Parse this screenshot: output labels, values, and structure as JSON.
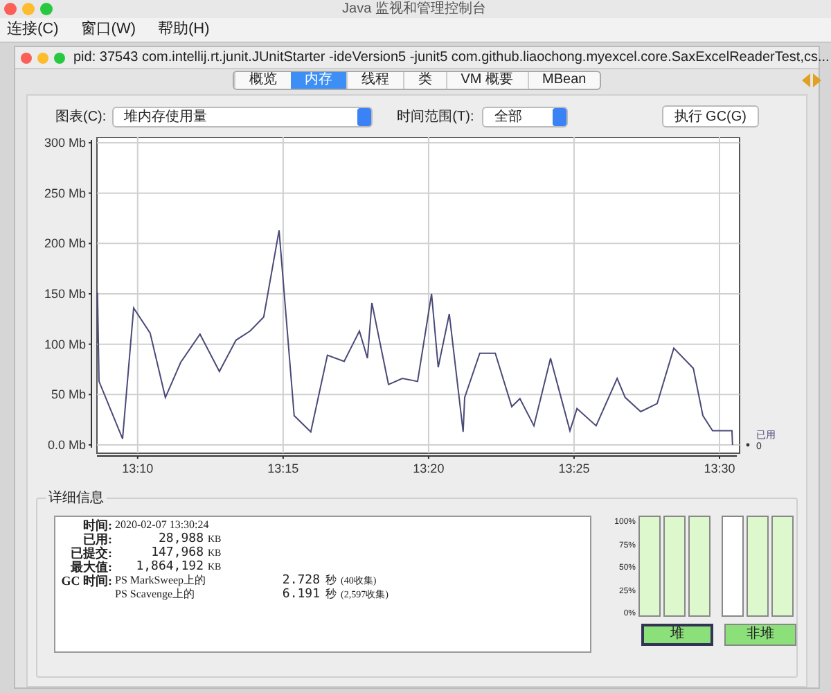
{
  "window": {
    "title": "Java 监视和管理控制台"
  },
  "menu": [
    "连接(C)",
    "窗口(W)",
    "帮助(H)"
  ],
  "inner_window": {
    "title": "pid: 37543 com.intellij.rt.junit.JUnitStarter -ideVersion5 -junit5 com.github.liaochong.myexcel.core.SaxExcelReaderTest,cs..."
  },
  "tabs": [
    {
      "label": "概览",
      "selected": false
    },
    {
      "label": "内存",
      "selected": true
    },
    {
      "label": "线程",
      "selected": false
    },
    {
      "label": "类",
      "selected": false
    },
    {
      "label": "VM 概要",
      "selected": false
    },
    {
      "label": "MBean",
      "selected": false
    }
  ],
  "chart_select": {
    "label": "图表(C):",
    "value": "堆内存使用量"
  },
  "range_select": {
    "label": "时间范围(T):",
    "value": "全部"
  },
  "gc_button": "执行 GC(G)",
  "memory_chart": {
    "chart_data": {
      "type": "line",
      "grid": true,
      "xlim": [
        788.6,
        810.5
      ],
      "ylim": [
        0,
        300
      ],
      "yticks": [
        {
          "value": 0,
          "label": "0.0 Mb"
        },
        {
          "value": 50,
          "label": "50 Mb"
        },
        {
          "value": 100,
          "label": "100 Mb"
        },
        {
          "value": 150,
          "label": "150 Mb"
        },
        {
          "value": 200,
          "label": "200 Mb"
        },
        {
          "value": 250,
          "label": "250 Mb"
        },
        {
          "value": 300,
          "label": "300 Mb"
        }
      ],
      "xticks": [
        {
          "value": 790,
          "label": "13:10"
        },
        {
          "value": 795,
          "label": "13:15"
        },
        {
          "value": 800,
          "label": "13:20"
        },
        {
          "value": 805,
          "label": "13:25"
        },
        {
          "value": 810,
          "label": "13:30"
        }
      ],
      "x": [
        788.62,
        788.67,
        789.48,
        789.86,
        790.43,
        790.95,
        791.48,
        792.14,
        792.81,
        793.38,
        793.86,
        794.33,
        794.86,
        795.38,
        795.95,
        796.52,
        797.1,
        797.62,
        797.9,
        798.05,
        798.62,
        799.1,
        799.62,
        800.1,
        800.33,
        800.71,
        801.19,
        801.24,
        801.76,
        802.29,
        802.86,
        803.14,
        803.62,
        804.19,
        804.86,
        805.1,
        805.76,
        806.48,
        806.76,
        807.29,
        807.86,
        808.43,
        809.1,
        809.43,
        809.76,
        810.43,
        810.45
      ],
      "series": [
        {
          "name": "已用",
          "color": "#4a4a78",
          "values": [
            151,
            63,
            6,
            136,
            111,
            47,
            82,
            110,
            73,
            104,
            113,
            127,
            213,
            29,
            13,
            89,
            83,
            113,
            86,
            141,
            60,
            66,
            63,
            150,
            77,
            130,
            13,
            47,
            91,
            91,
            38,
            46,
            19,
            86,
            14,
            36,
            19,
            66,
            47,
            33,
            41,
            96,
            76,
            29,
            14,
            14,
            0
          ]
        }
      ]
    },
    "legend_value": "0"
  },
  "details": {
    "title": "详细信息",
    "rows": [
      {
        "kind": "plain",
        "label": "时间:",
        "value": "2020-02-07 13:30:24"
      },
      {
        "kind": "size",
        "label": "已用:",
        "value": "28,988",
        "unit": "KB"
      },
      {
        "kind": "size",
        "label": "已提交:",
        "value": "147,968",
        "unit": "KB"
      },
      {
        "kind": "size",
        "label": "最大值:",
        "value": "1,864,192",
        "unit": "KB"
      },
      {
        "kind": "gc",
        "label": "GC 时间:",
        "collector": "PS MarkSweep上的",
        "time": "2.728",
        "unit": "秒",
        "count": "(40收集)"
      },
      {
        "kind": "gc",
        "collector": "PS Scavenge上的",
        "time": "6.191",
        "unit": "秒",
        "count": "(2,597收集)"
      }
    ]
  },
  "pool_chart": {
    "scale": [
      "100%",
      "75%",
      "50%",
      "25%",
      "0%"
    ],
    "groups": [
      {
        "label": "堆",
        "selected": true,
        "bars": [
          {
            "level": 1
          },
          {
            "level": 1
          },
          {
            "level": 1
          }
        ]
      },
      {
        "label": "非堆",
        "selected": false,
        "bars": [
          {
            "level": 0
          },
          {
            "level": 1
          },
          {
            "level": 1
          }
        ]
      }
    ]
  }
}
